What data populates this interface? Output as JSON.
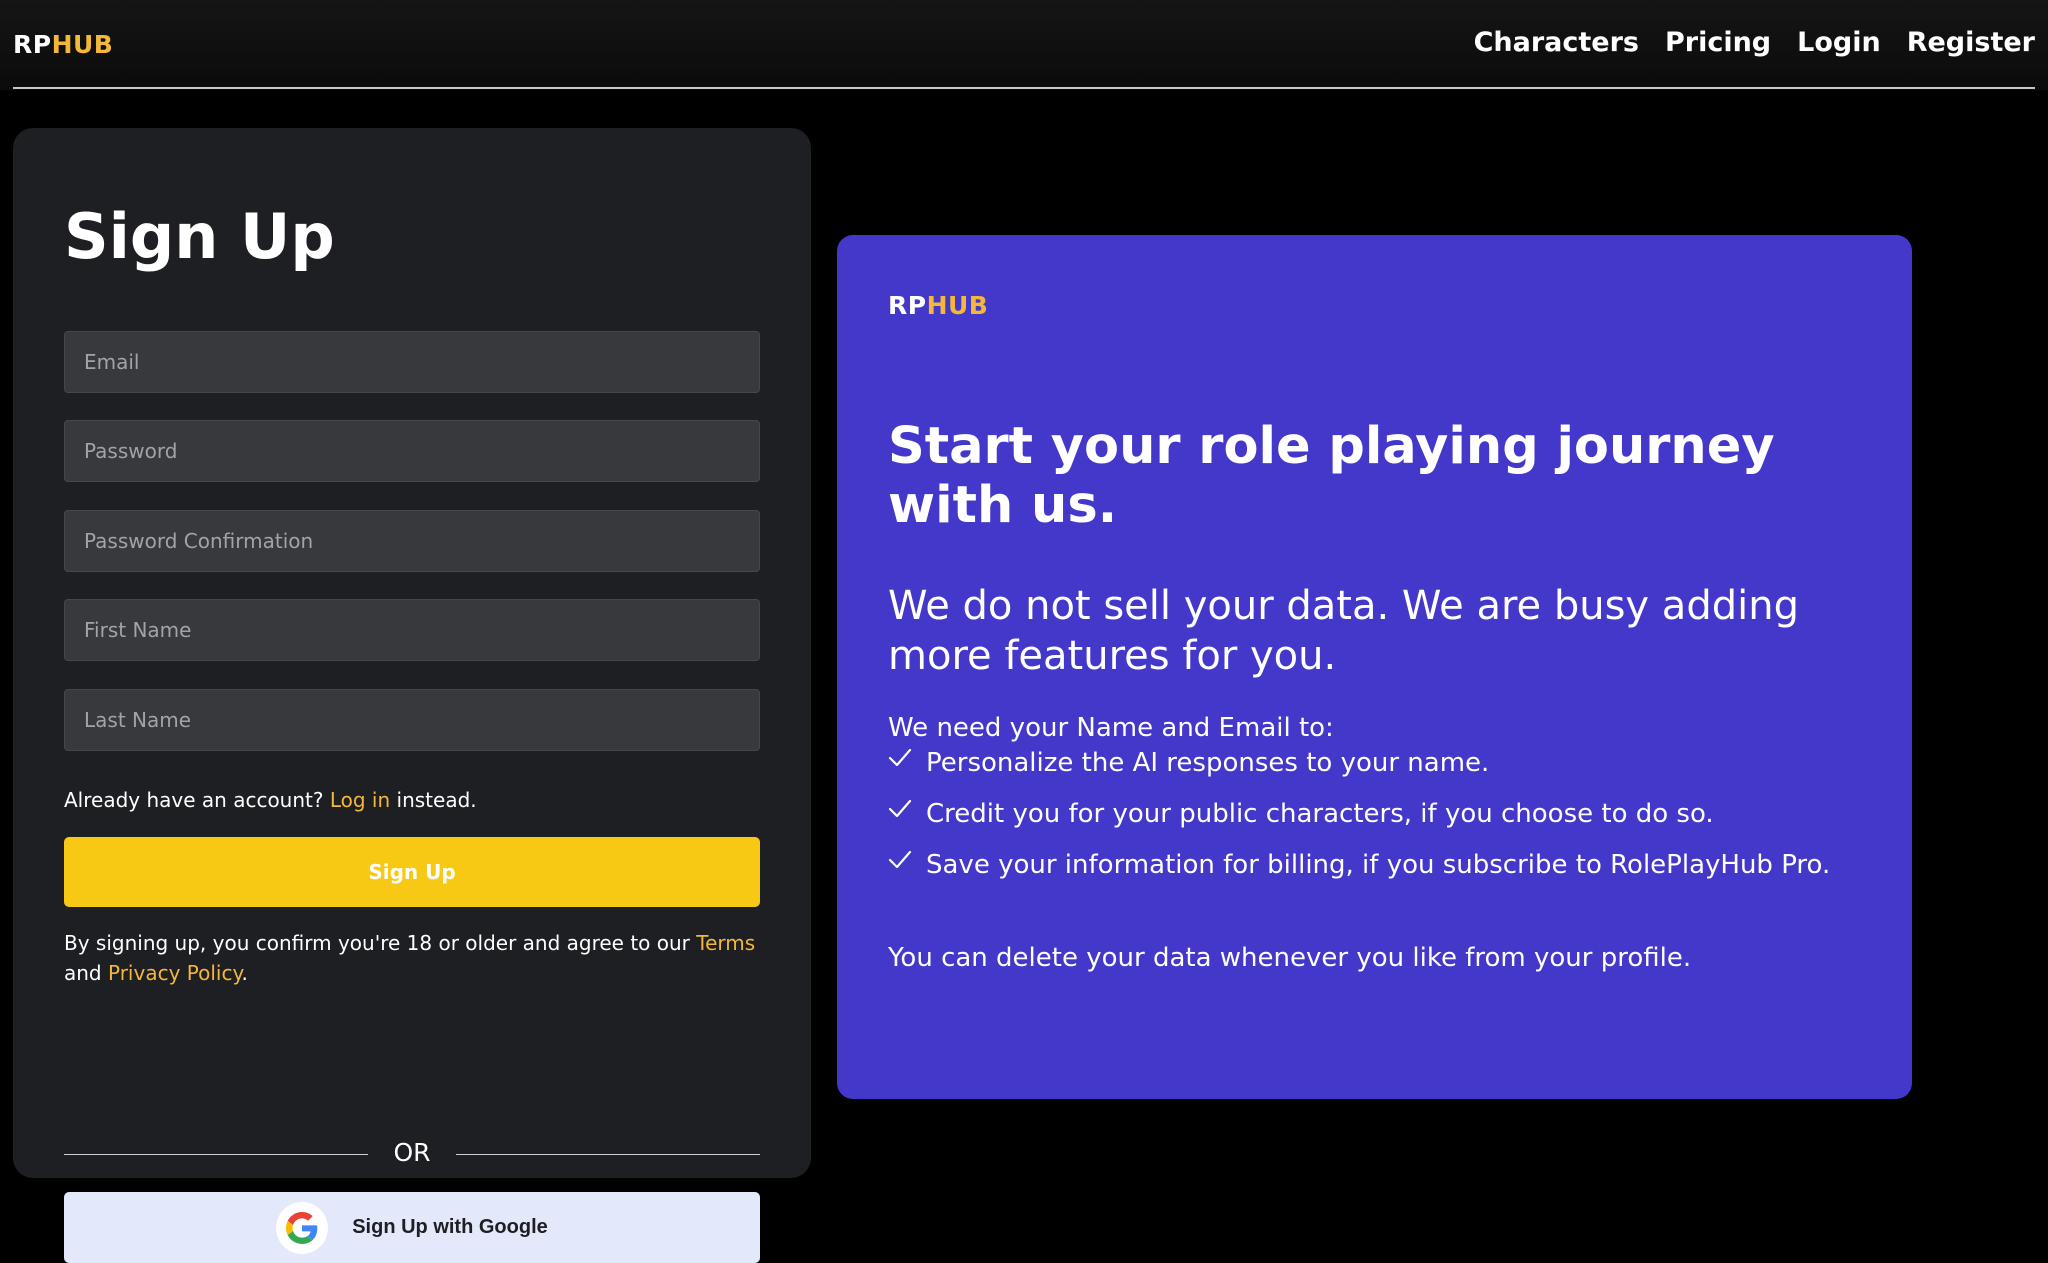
{
  "header": {
    "logo_rp": "RP",
    "logo_hub": "HUB",
    "nav": [
      "Characters",
      "Pricing",
      "Login",
      "Register"
    ]
  },
  "signup": {
    "title": "Sign Up",
    "fields": {
      "email": "Email",
      "password": "Password",
      "password_confirmation": "Password Confirmation",
      "first_name": "First Name",
      "last_name": "Last Name"
    },
    "already_prefix": "Already have an account?",
    "login_link": "Log in",
    "already_suffix": "instead.",
    "button_label": "Sign Up",
    "terms_prefix": "By signing up, you confirm you're 18 or older and agree to our",
    "terms_link": "Terms",
    "terms_and": "and",
    "privacy_link": "Privacy Policy",
    "terms_end": ".",
    "or_label": "OR",
    "google_label": "Sign Up with Google"
  },
  "promo": {
    "logo_rp": "RP",
    "logo_hub": "HUB",
    "headline": "Start your role playing journey with us.",
    "subheadline": "We do not sell your data. We are busy adding more features for you.",
    "need_intro": "We need your Name and Email to:",
    "checks": [
      "Personalize the AI responses to your name.",
      "Credit you for your public characters, if you choose to do so.",
      "Save your information for billing, if you subscribe to RolePlayHub Pro."
    ],
    "delete_note": "You can delete your data whenever you like from your profile."
  },
  "colors": {
    "accent_yellow": "#f7c814",
    "link_gold": "#f3b73a",
    "promo_blue": "#4338ca",
    "card_dark": "#1d1f23"
  },
  "icons": {
    "check": "check-icon",
    "google": "google-logo-icon"
  }
}
